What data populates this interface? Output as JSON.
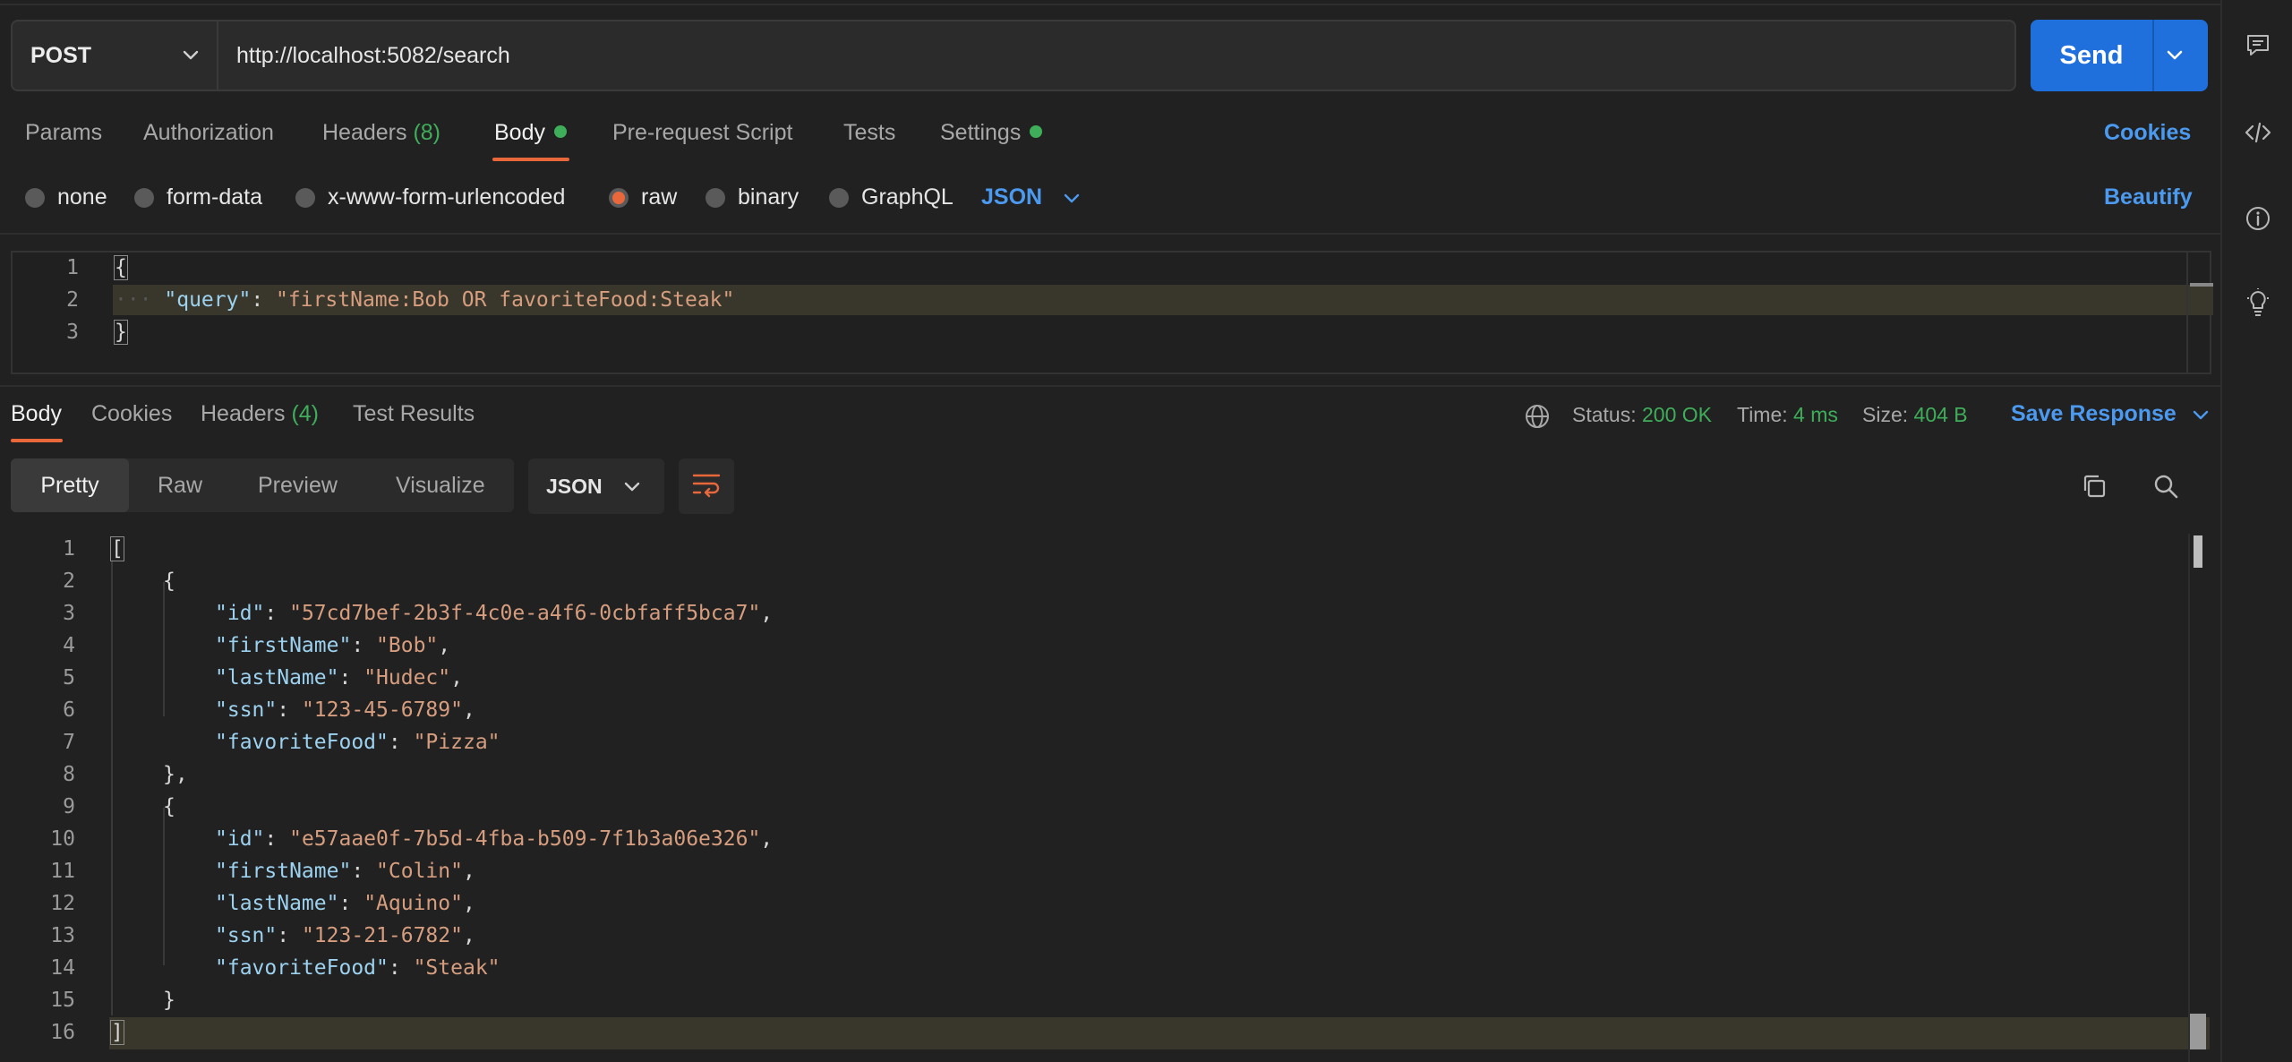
{
  "request": {
    "method": "POST",
    "url": "http://localhost:5082/search",
    "send_label": "Send"
  },
  "request_tabs": {
    "params": "Params",
    "authorization": "Authorization",
    "headers": "Headers",
    "headers_count": "(8)",
    "body": "Body",
    "prerequest": "Pre-request Script",
    "tests": "Tests",
    "settings": "Settings",
    "cookies": "Cookies"
  },
  "body_types": {
    "none": "none",
    "form_data": "form-data",
    "urlencoded": "x-www-form-urlencoded",
    "raw": "raw",
    "binary": "binary",
    "graphql": "GraphQL",
    "selected": "raw",
    "language": "JSON",
    "beautify": "Beautify"
  },
  "request_body": {
    "lines": [
      {
        "num": "1",
        "open": "{"
      },
      {
        "num": "2",
        "key": "\"query\"",
        "colon": ": ",
        "value": "\"firstName:Bob OR favoriteFood:Steak\""
      },
      {
        "num": "3",
        "close": "}"
      }
    ]
  },
  "response_tabs": {
    "body": "Body",
    "cookies": "Cookies",
    "headers": "Headers",
    "headers_count": "(4)",
    "test_results": "Test Results"
  },
  "response_status": {
    "status_label": "Status:",
    "status_value": "200 OK",
    "time_label": "Time:",
    "time_value": "4 ms",
    "size_label": "Size:",
    "size_value": "404 B",
    "save_response": "Save Response"
  },
  "response_views": {
    "pretty": "Pretty",
    "raw": "Raw",
    "preview": "Preview",
    "visualize": "Visualize",
    "format": "JSON"
  },
  "response_body": {
    "line_numbers": [
      "1",
      "2",
      "3",
      "4",
      "5",
      "6",
      "7",
      "8",
      "9",
      "10",
      "11",
      "12",
      "13",
      "14",
      "15",
      "16"
    ],
    "l1": "[",
    "l2": "{",
    "l3_key": "\"id\"",
    "l3_val": "\"57cd7bef-2b3f-4c0e-a4f6-0cbfaff5bca7\"",
    "l4_key": "\"firstName\"",
    "l4_val": "\"Bob\"",
    "l5_key": "\"lastName\"",
    "l5_val": "\"Hudec\"",
    "l6_key": "\"ssn\"",
    "l6_val": "\"123-45-6789\"",
    "l7_key": "\"favoriteFood\"",
    "l7_val": "\"Pizza\"",
    "l8": "},",
    "l9": "{",
    "l10_key": "\"id\"",
    "l10_val": "\"e57aae0f-7b5d-4fba-b509-7f1b3a06e326\"",
    "l11_key": "\"firstName\"",
    "l11_val": "\"Colin\"",
    "l12_key": "\"lastName\"",
    "l12_val": "\"Aquino\"",
    "l13_key": "\"ssn\"",
    "l13_val": "\"123-21-6782\"",
    "l14_key": "\"favoriteFood\"",
    "l14_val": "\"Steak\"",
    "l15": "}",
    "l16": "]",
    "colon": ": ",
    "comma": ","
  },
  "colors": {
    "accent_orange": "#e8683b",
    "send_blue": "#1f6fdc",
    "link_blue": "#4c9af0",
    "status_green": "#3fae5a"
  },
  "icons": {
    "right_sidebar": [
      "comment-icon",
      "code-icon",
      "info-icon",
      "lightbulb-icon"
    ],
    "toolbar": [
      "copy-icon",
      "search-icon",
      "wrap-lines-icon",
      "globe-icon"
    ]
  }
}
